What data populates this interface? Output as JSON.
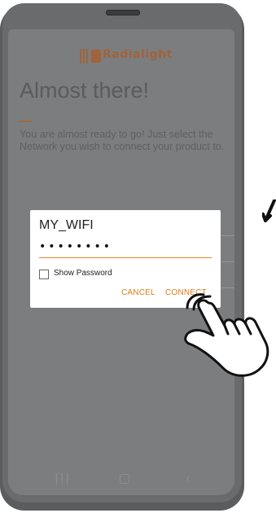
{
  "app": {
    "logo_text": "Radialight",
    "heading": "Almost there!",
    "description": "You are almost ready to go! Just select the Network you wish to connect your product to."
  },
  "dialog": {
    "network_name": "MY_WIFI",
    "password_masked": "••••••••",
    "show_password_label": "Show Password",
    "show_password_checked": false,
    "cancel_label": "CANCEL",
    "connect_label": "CONNECT"
  },
  "nav": {
    "recent_icon": "recent-apps-icon",
    "home_icon": "home-icon",
    "back_icon": "back-icon"
  },
  "colors": {
    "accent": "#e07a1a",
    "frame": "#5b5c5e",
    "scrim": "#7c7d7f"
  }
}
